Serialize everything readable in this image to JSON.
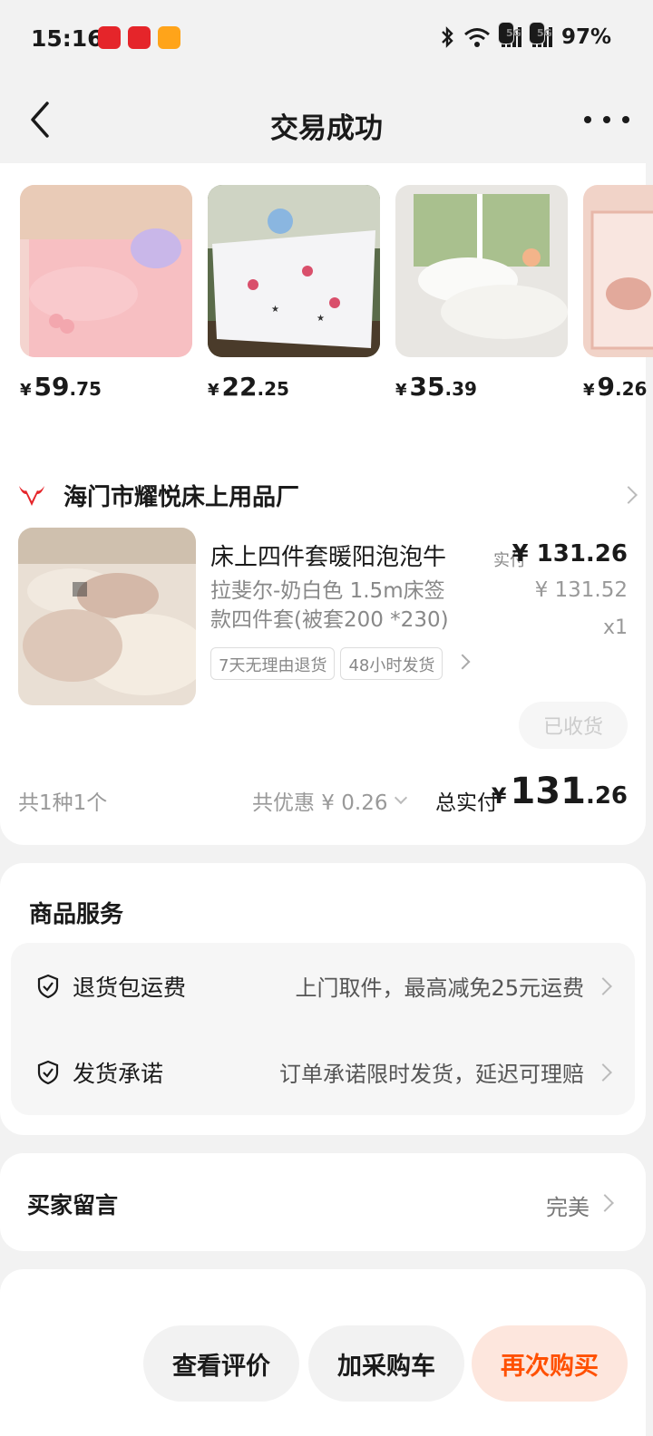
{
  "status_bar": {
    "time": "15:16",
    "battery": "97%",
    "net1": "5G",
    "net2": "5G",
    "icons": [
      "bluetooth-icon",
      "wifi-icon",
      "signal-icon",
      "signal-icon"
    ]
  },
  "header": {
    "title": "交易成功"
  },
  "recommendations": [
    {
      "yen": "¥",
      "int": "59",
      "dec": ".75"
    },
    {
      "yen": "¥",
      "int": "22",
      "dec": ".25"
    },
    {
      "yen": "¥",
      "int": "35",
      "dec": ".39"
    },
    {
      "yen": "¥",
      "int": "9",
      "dec": ".26"
    }
  ],
  "shop": {
    "name": "海门市耀悦床上用品厂"
  },
  "product": {
    "title": "床上四件套暖阳泡泡牛",
    "sku_line1": "拉斐尔-奶白色 1.5m床签",
    "sku_line2": "款四件套(被套200 *230)",
    "paid_label": "实付",
    "paid_price": "¥ 131.26",
    "original_price": "¥ 131.52",
    "quantity": "x1",
    "tags": [
      "7天无理由退货",
      "48小时发货"
    ],
    "received_label": "已收货"
  },
  "summary": {
    "count": "共1种1个",
    "discount": "共优惠 ¥ 0.26",
    "total_label": "总实付",
    "total_yen": "¥",
    "total_int": "131",
    "total_dec": ".26"
  },
  "services": {
    "title": "商品服务",
    "items": [
      {
        "name": "退货包运费",
        "desc": "上门取件，最高减免25元运费"
      },
      {
        "name": "发货承诺",
        "desc": "订单承诺限时发货，延迟可理赔"
      }
    ]
  },
  "message": {
    "title": "买家留言",
    "value": "完美"
  },
  "actions": {
    "review": "查看评价",
    "add_cart": "加采购车",
    "rebuy": "再次购买"
  },
  "colors": {
    "accent": "#ff5000",
    "accent_bg": "#fde6dd",
    "shop_red": "#e5252a"
  }
}
